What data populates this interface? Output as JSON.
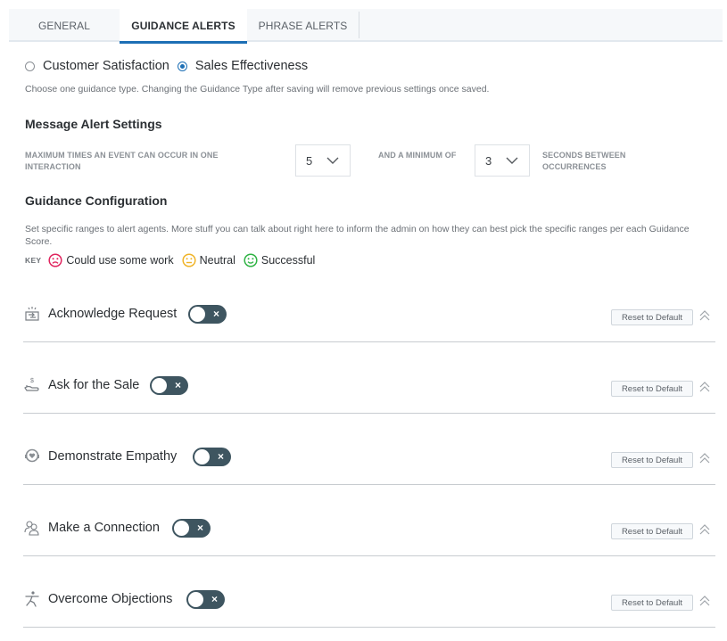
{
  "tabs": [
    {
      "label": "GENERAL",
      "active": false
    },
    {
      "label": "GUIDANCE ALERTS",
      "active": true
    },
    {
      "label": "PHRASE ALERTS",
      "active": false
    }
  ],
  "guidance_type": {
    "options": [
      {
        "label": "Customer Satisfaction",
        "checked": false
      },
      {
        "label": "Sales Effectiveness",
        "checked": true
      }
    ],
    "hint": "Choose one guidance type. Changing the Guidance Type after saving will remove previous settings once saved."
  },
  "message_alert_settings": {
    "title": "Message Alert Settings",
    "max_label": "MAXIMUM TIMES AN EVENT CAN OCCUR IN ONE INTERACTION",
    "max_value": "5",
    "min_label": "AND A MINIMUM OF",
    "min_value": "3",
    "seconds_label": "SECONDS BETWEEN OCCURRENCES"
  },
  "guidance_configuration": {
    "title": "Guidance Configuration",
    "description": "Set specific ranges to alert agents. More stuff you can talk about right here to inform the admin on how they can best pick the specific ranges per each Guidance Score.",
    "key_label": "KEY",
    "key": [
      {
        "label": "Could use some work",
        "icon": "sad-face-icon",
        "color": "#e0245e"
      },
      {
        "label": "Neutral",
        "icon": "neutral-face-icon",
        "color": "#f0b429"
      },
      {
        "label": "Successful",
        "icon": "happy-face-icon",
        "color": "#2fb344"
      }
    ]
  },
  "items": [
    {
      "title": "Acknowledge Request",
      "icon": "acknowledge-icon",
      "enabled": false,
      "reset_label": "Reset to Default"
    },
    {
      "title": "Ask for the Sale",
      "icon": "hand-dollar-icon",
      "enabled": false,
      "reset_label": "Reset to Default"
    },
    {
      "title": "Demonstrate Empathy",
      "icon": "empathy-heart-icon",
      "enabled": false,
      "reset_label": "Reset to Default"
    },
    {
      "title": "Make a Connection",
      "icon": "people-icon",
      "enabled": false,
      "reset_label": "Reset to Default"
    },
    {
      "title": "Overcome Objections",
      "icon": "running-person-icon",
      "enabled": false,
      "reset_label": "Reset to Default"
    }
  ],
  "colors": {
    "accent": "#1d6fb5",
    "toggle_off": "#3e5560"
  }
}
